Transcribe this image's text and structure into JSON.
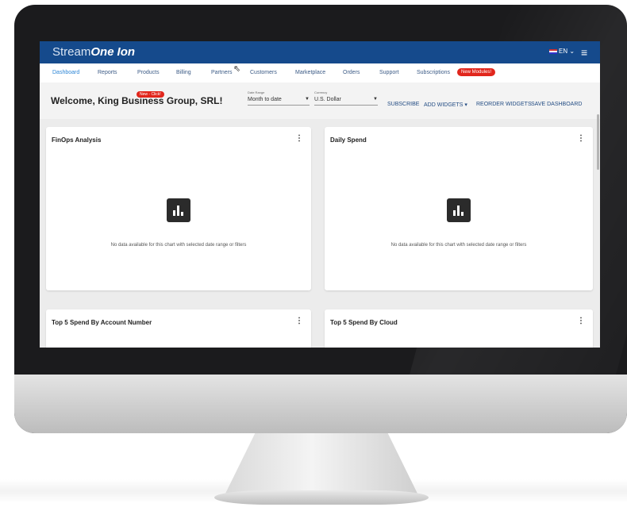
{
  "brand": {
    "part1": "Stream",
    "part2": "One",
    "part3": "Ion"
  },
  "header": {
    "language": "EN",
    "language_icon": "chevron-down-icon",
    "menu_icon": "hamburger-menu-icon"
  },
  "nav": {
    "items": [
      "Dashboard",
      "Reports",
      "Products",
      "Billing",
      "Partners",
      "Customers",
      "Marketplace",
      "Orders",
      "Support",
      "Subscriptions"
    ],
    "active": "Dashboard",
    "badge": "New Modules!"
  },
  "welcome": {
    "text": "Welcome, King Business Group, SRL!",
    "badge": "New - Click!"
  },
  "filters": {
    "date_range_label": "Date Range",
    "date_range_value": "Month to date",
    "currency_label": "Currency",
    "currency_value": "U.S. Dollar"
  },
  "actions": {
    "subscribe": "SUBSCRIBE",
    "add_widgets": "ADD WIDGETS",
    "reorder": "REORDER WIDGETS",
    "save": "SAVE DASHBOARD"
  },
  "cards": [
    {
      "title": "FinOps Analysis",
      "message": "No data available for this chart with selected date range or filters"
    },
    {
      "title": "Daily Spend",
      "message": "No data available for this chart with selected date range or filters"
    },
    {
      "title": "Top 5 Spend By Account Number"
    },
    {
      "title": "Top 5 Spend By Cloud"
    }
  ],
  "colors": {
    "topbar": "#154a8c",
    "badge": "#e1261c",
    "link": "#244d84"
  }
}
